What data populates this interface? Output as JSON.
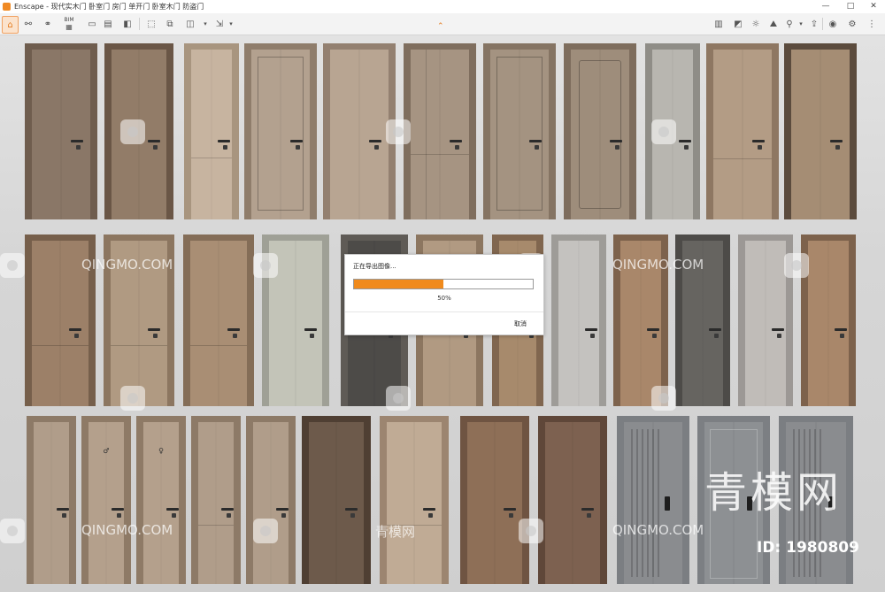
{
  "window": {
    "app_name": "Enscape",
    "title": "Enscape - 现代实木门 卧室门 房门 单开门 卧室木门 防盗门",
    "controls": [
      "—",
      "□",
      "✕"
    ]
  },
  "toolbar": {
    "bim_label": "BIM",
    "left_icons": [
      "home-icon",
      "link-icon",
      "binoculars-icon",
      "bim-icon",
      "video-icon",
      "clapper-icon",
      "screenshot-icon",
      "batch-render-icon",
      "panorama-icon",
      "export-icon"
    ],
    "right_icons": [
      "asset-library-icon",
      "material-editor-icon",
      "sun-icon",
      "site-context-icon",
      "bookmark-icon",
      "upload-icon",
      "visual-settings-icon",
      "settings-icon"
    ]
  },
  "progress_dialog": {
    "title": "正在导出图像...",
    "percent": 50,
    "percent_text": "50%",
    "cancel_label": "取消",
    "fill_color": "#f08a1c"
  },
  "watermarks": {
    "site": "QINGMO.COM",
    "site_cn": "青模网",
    "big": "青模网",
    "id_text": "ID: 1980809"
  },
  "colors": {
    "accent": "#e37d22",
    "toolbar_bg": "#f3f3f3",
    "viewport_bg": "#d6d6d6"
  }
}
